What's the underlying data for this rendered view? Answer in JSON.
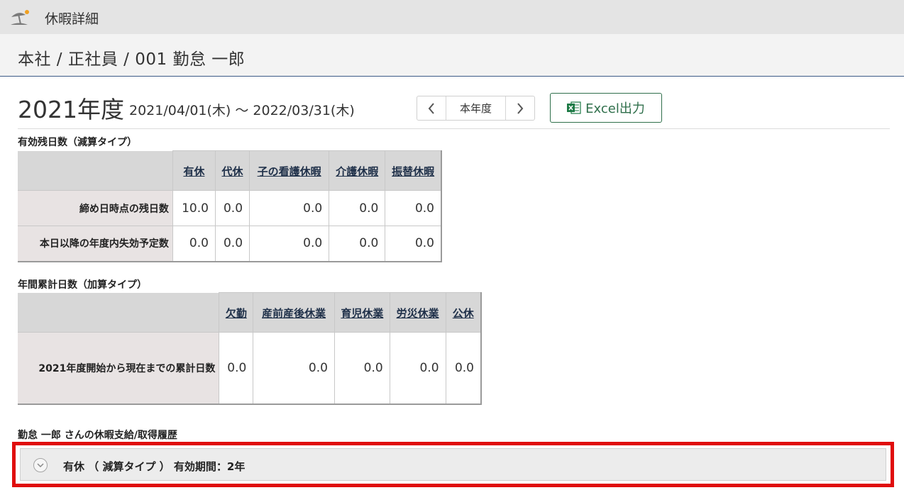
{
  "header": {
    "app_title": "休暇詳細",
    "app_icon": "beach-umbrella-icon"
  },
  "breadcrumb": "本社 / 正社員 / 001 勤怠 一郎",
  "period": {
    "year_label": "2021年度",
    "range": "2021/04/01(木) ～ 2022/03/31(木)"
  },
  "year_nav": {
    "prev_icon": "chevron-left-icon",
    "current_label": "本年度",
    "next_icon": "chevron-right-icon"
  },
  "export": {
    "label": "Excel出力",
    "icon": "excel-icon",
    "color": "#2f6f4b"
  },
  "remaining": {
    "title": "有効残日数（減算タイプ）",
    "columns": [
      "有休",
      "代休",
      "子の看護休暇",
      "介護休暇",
      "振替休暇"
    ],
    "rows": [
      {
        "label": "締め日時点の残日数",
        "values": [
          "10.0",
          "0.0",
          "0.0",
          "0.0",
          "0.0"
        ]
      },
      {
        "label": "本日以降の年度内失効予定数",
        "values": [
          "0.0",
          "0.0",
          "0.0",
          "0.0",
          "0.0"
        ]
      }
    ]
  },
  "cumulative": {
    "title": "年間累計日数（加算タイプ）",
    "columns": [
      "欠勤",
      "産前産後休業",
      "育児休業",
      "労災休業",
      "公休"
    ],
    "rows": [
      {
        "label": "2021年度開始から現在までの累計日数",
        "values": [
          "0.0",
          "0.0",
          "0.0",
          "0.0",
          "0.0"
        ]
      }
    ]
  },
  "history": {
    "title": "勤怠 一郎 さんの休暇支給/取得履歴",
    "item_summary": "有休 （ 減算タイプ ） 有効期間：2年",
    "highlight_color": "#e00d0d"
  }
}
